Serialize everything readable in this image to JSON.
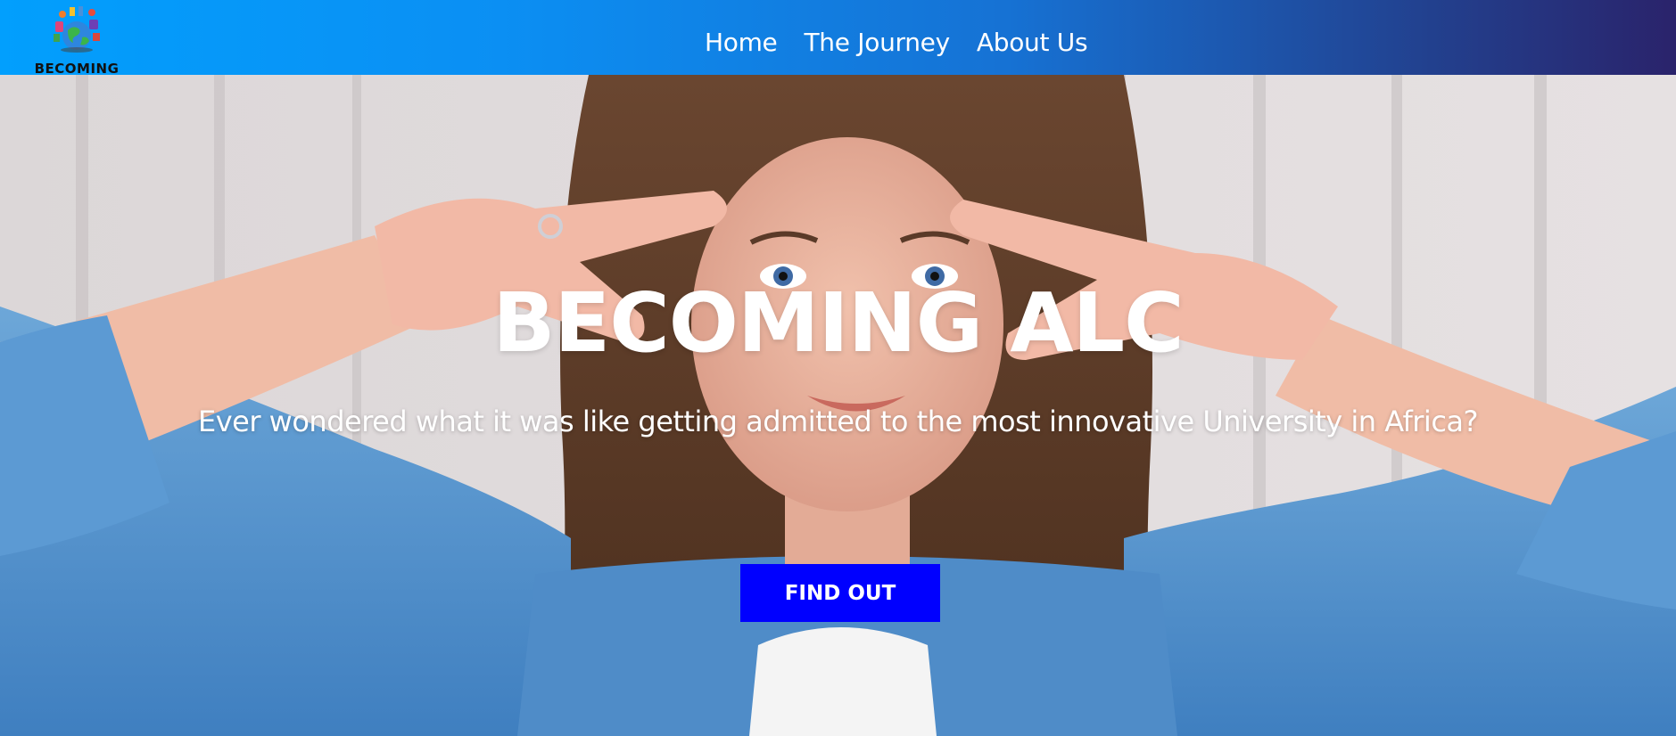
{
  "header": {
    "logo_text": "BECOMING",
    "nav": [
      {
        "label": "Home"
      },
      {
        "label": "The Journey"
      },
      {
        "label": "About Us"
      }
    ]
  },
  "hero": {
    "title": "BECOMING ALC",
    "subtitle": "Ever wondered what it was like getting admitted to the most innovative University in Africa?",
    "cta_label": "FIND OUT",
    "image_icon": "woman-peace-sign-photo"
  },
  "colors": {
    "nav_gradient_start": "#029ffd",
    "nav_gradient_end": "#2a236b",
    "cta_background": "#0000ff",
    "text": "#ffffff"
  }
}
